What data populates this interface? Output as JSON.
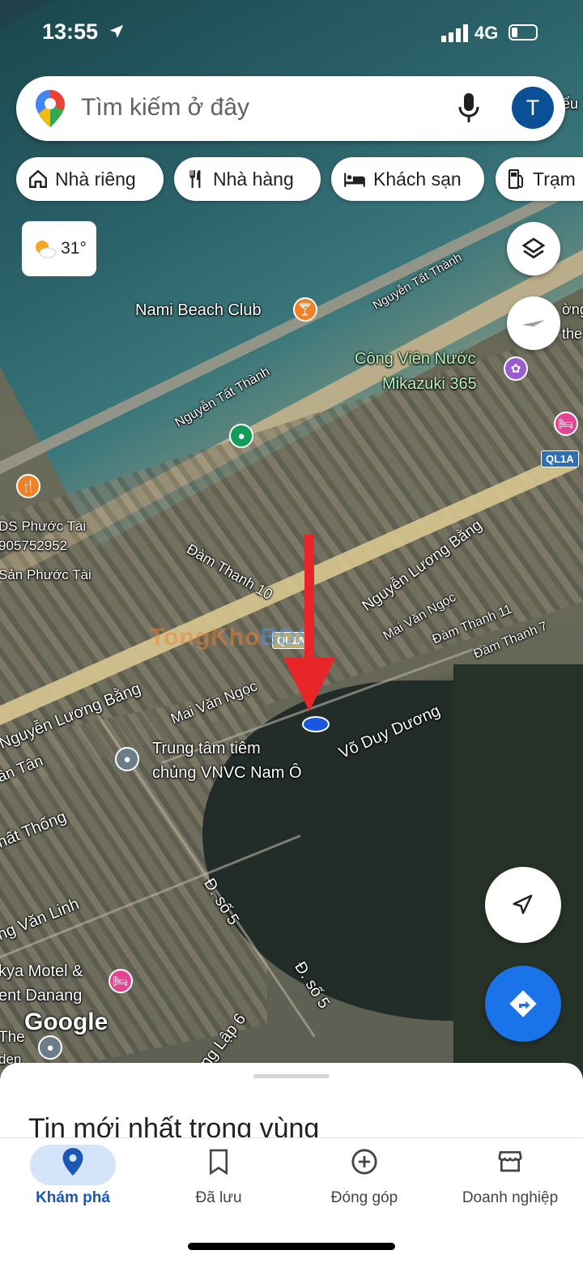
{
  "status_bar": {
    "time": "13:55",
    "network": "4G"
  },
  "search": {
    "placeholder": "Tìm kiếm ở đây",
    "avatar_letter": "T"
  },
  "chips": [
    "Nhà riêng",
    "Nhà hàng",
    "Khách sạn",
    "Trạm"
  ],
  "weather": {
    "temp": "31°"
  },
  "map_labels": {
    "nami": "Nami Beach Club",
    "nguyen_tat_thanh_1": "Nguyễn Tất Thành",
    "nguyen_tat_thanh_2": "Nguyễn Tất Thành",
    "cong_vien_1": "Công Viên Nước",
    "cong_vien_2": "Mikazuki 365",
    "ql1a_1": "QL1A",
    "ql1a_2": "QL1A",
    "ds_phuoc_tai": "DS Phước Tài",
    "phone": "905752952",
    "san_phuoc_tai": "Sản Phước Tài",
    "dam_thanh_10": "Đàm Thanh 10",
    "nguyen_luong_bang_1": "Nguyễn Lương Bằng",
    "nguyen_luong_bang_2": "Nguyễn Lương Bằng",
    "mai_van_ngoc_1": "Mai Văn Ngọc",
    "mai_van_ngoc_2": "Mai Văn Ngọc",
    "dam_thanh_11": "Đàm Thanh 11",
    "dam_thanh_7": "Đàm Thanh 7",
    "vo_duy_duong": "Võ Duy Dương",
    "vnvc_1": "Trung tâm tiêm",
    "vnvc_2": "chủng VNVC Nam Ô",
    "an_tan": "ần Tân",
    "nhat_thong": "hất Thống",
    "van_linh": "ng Văn Linh",
    "d_so5_1": "Đ. số 5",
    "d_so5_2": "Đ. số 5",
    "motel_1": "kya Motel &",
    "motel_2": "ent Danang",
    "lap_6": "ng Lập 6",
    "the": "The",
    "den": "den",
    "right_edge_1": "ểu",
    "right_edge_2": "ờng",
    "right_edge_3": "the",
    "google": "Google"
  },
  "watermark": {
    "part1": "TongKho",
    "part2": "BDS"
  },
  "sheet": {
    "title": "Tin mới nhất trong vùng"
  },
  "nav": [
    "Khám phá",
    "Đã lưu",
    "Đóng góp",
    "Doanh nghiệp"
  ],
  "colors": {
    "accent": "#1a73e8",
    "poi_orange": "#f08127",
    "poi_pink": "#e44593",
    "arrow": "#e8262a"
  }
}
